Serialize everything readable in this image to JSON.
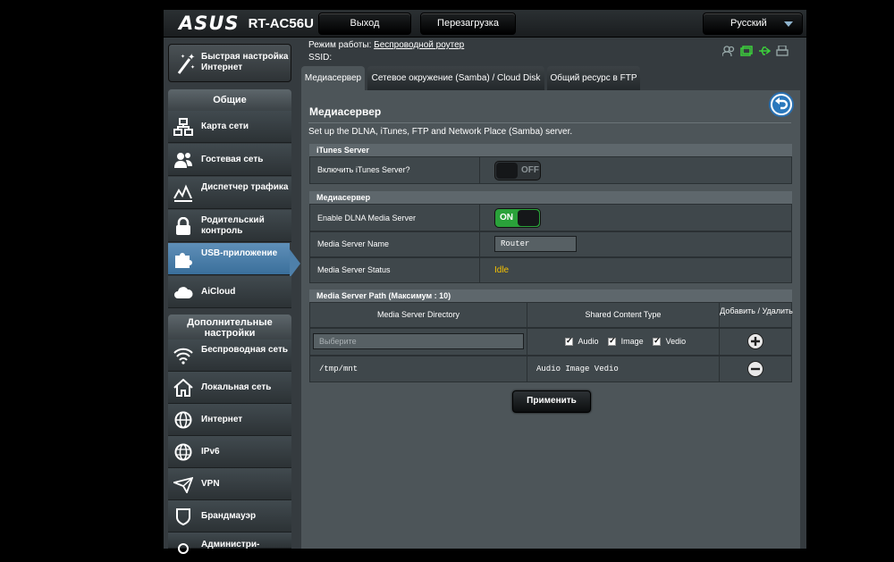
{
  "header": {
    "logo": "ASUS",
    "model": "RT-AC56U",
    "logout_label": "Выход",
    "reboot_label": "Перезагрузка",
    "language": "Русский"
  },
  "info": {
    "mode_label": "Режим работы:",
    "mode_value": "Беспроводной роутер",
    "ssid_label": "SSID:"
  },
  "sidebar": {
    "quick_setup": "Быстрая настройка Интернет",
    "general_title": "Общие",
    "general_items": [
      {
        "label": "Карта сети",
        "icon": "network-map-icon"
      },
      {
        "label": "Гостевая сеть",
        "icon": "guest-network-icon"
      },
      {
        "label": "Диспетчер трафика",
        "icon": "traffic-manager-icon"
      },
      {
        "label": "Родительский контроль",
        "icon": "lock-icon"
      },
      {
        "label": "USB-приложение",
        "icon": "puzzle-icon",
        "active": true
      },
      {
        "label": "AiCloud",
        "icon": "cloud-icon"
      }
    ],
    "advanced_title": "Дополнительные настройки",
    "advanced_items": [
      {
        "label": "Беспроводная сеть",
        "icon": "wifi-icon"
      },
      {
        "label": "Локальная сеть",
        "icon": "home-icon"
      },
      {
        "label": "Интернет",
        "icon": "globe-icon"
      },
      {
        "label": "IPv6",
        "icon": "ipv6-globe-icon"
      },
      {
        "label": "VPN",
        "icon": "vpn-icon"
      },
      {
        "label": "Брандмауэр",
        "icon": "shield-icon"
      },
      {
        "label": "Администри-",
        "icon": "admin-icon"
      }
    ]
  },
  "tabs": [
    {
      "label": "Медиасервер",
      "active": true
    },
    {
      "label": "Сетевое окружение (Samba) / Cloud Disk"
    },
    {
      "label": "Общий ресурс в FTP"
    }
  ],
  "main": {
    "title": "Медиасервер",
    "description": "Set up the DLNA, iTunes, FTP and Network Place (Samba) server.",
    "itunes": {
      "header": "iTunes Server",
      "enable_label": "Включить iTunes Server?",
      "state": "OFF"
    },
    "media": {
      "header": "Медиасервер",
      "dlna_label": "Enable DLNA Media Server",
      "dlna_state": "ON",
      "name_label": "Media Server Name",
      "name_value": "Router",
      "status_label": "Media Server Status",
      "status_value": "Idle"
    },
    "paths": {
      "header": "Media Server Path (Максимум : 10)",
      "col_dir": "Media Server Directory",
      "col_type": "Shared Content Type",
      "col_action": "Добавить / Удалить",
      "placeholder": "Выберите",
      "type_audio": "Audio",
      "type_image": "Image",
      "type_video": "Vedio",
      "rows": [
        {
          "dir": "/tmp/mnt",
          "types": "Audio Image Vedio"
        }
      ]
    },
    "apply_label": "Применить"
  }
}
